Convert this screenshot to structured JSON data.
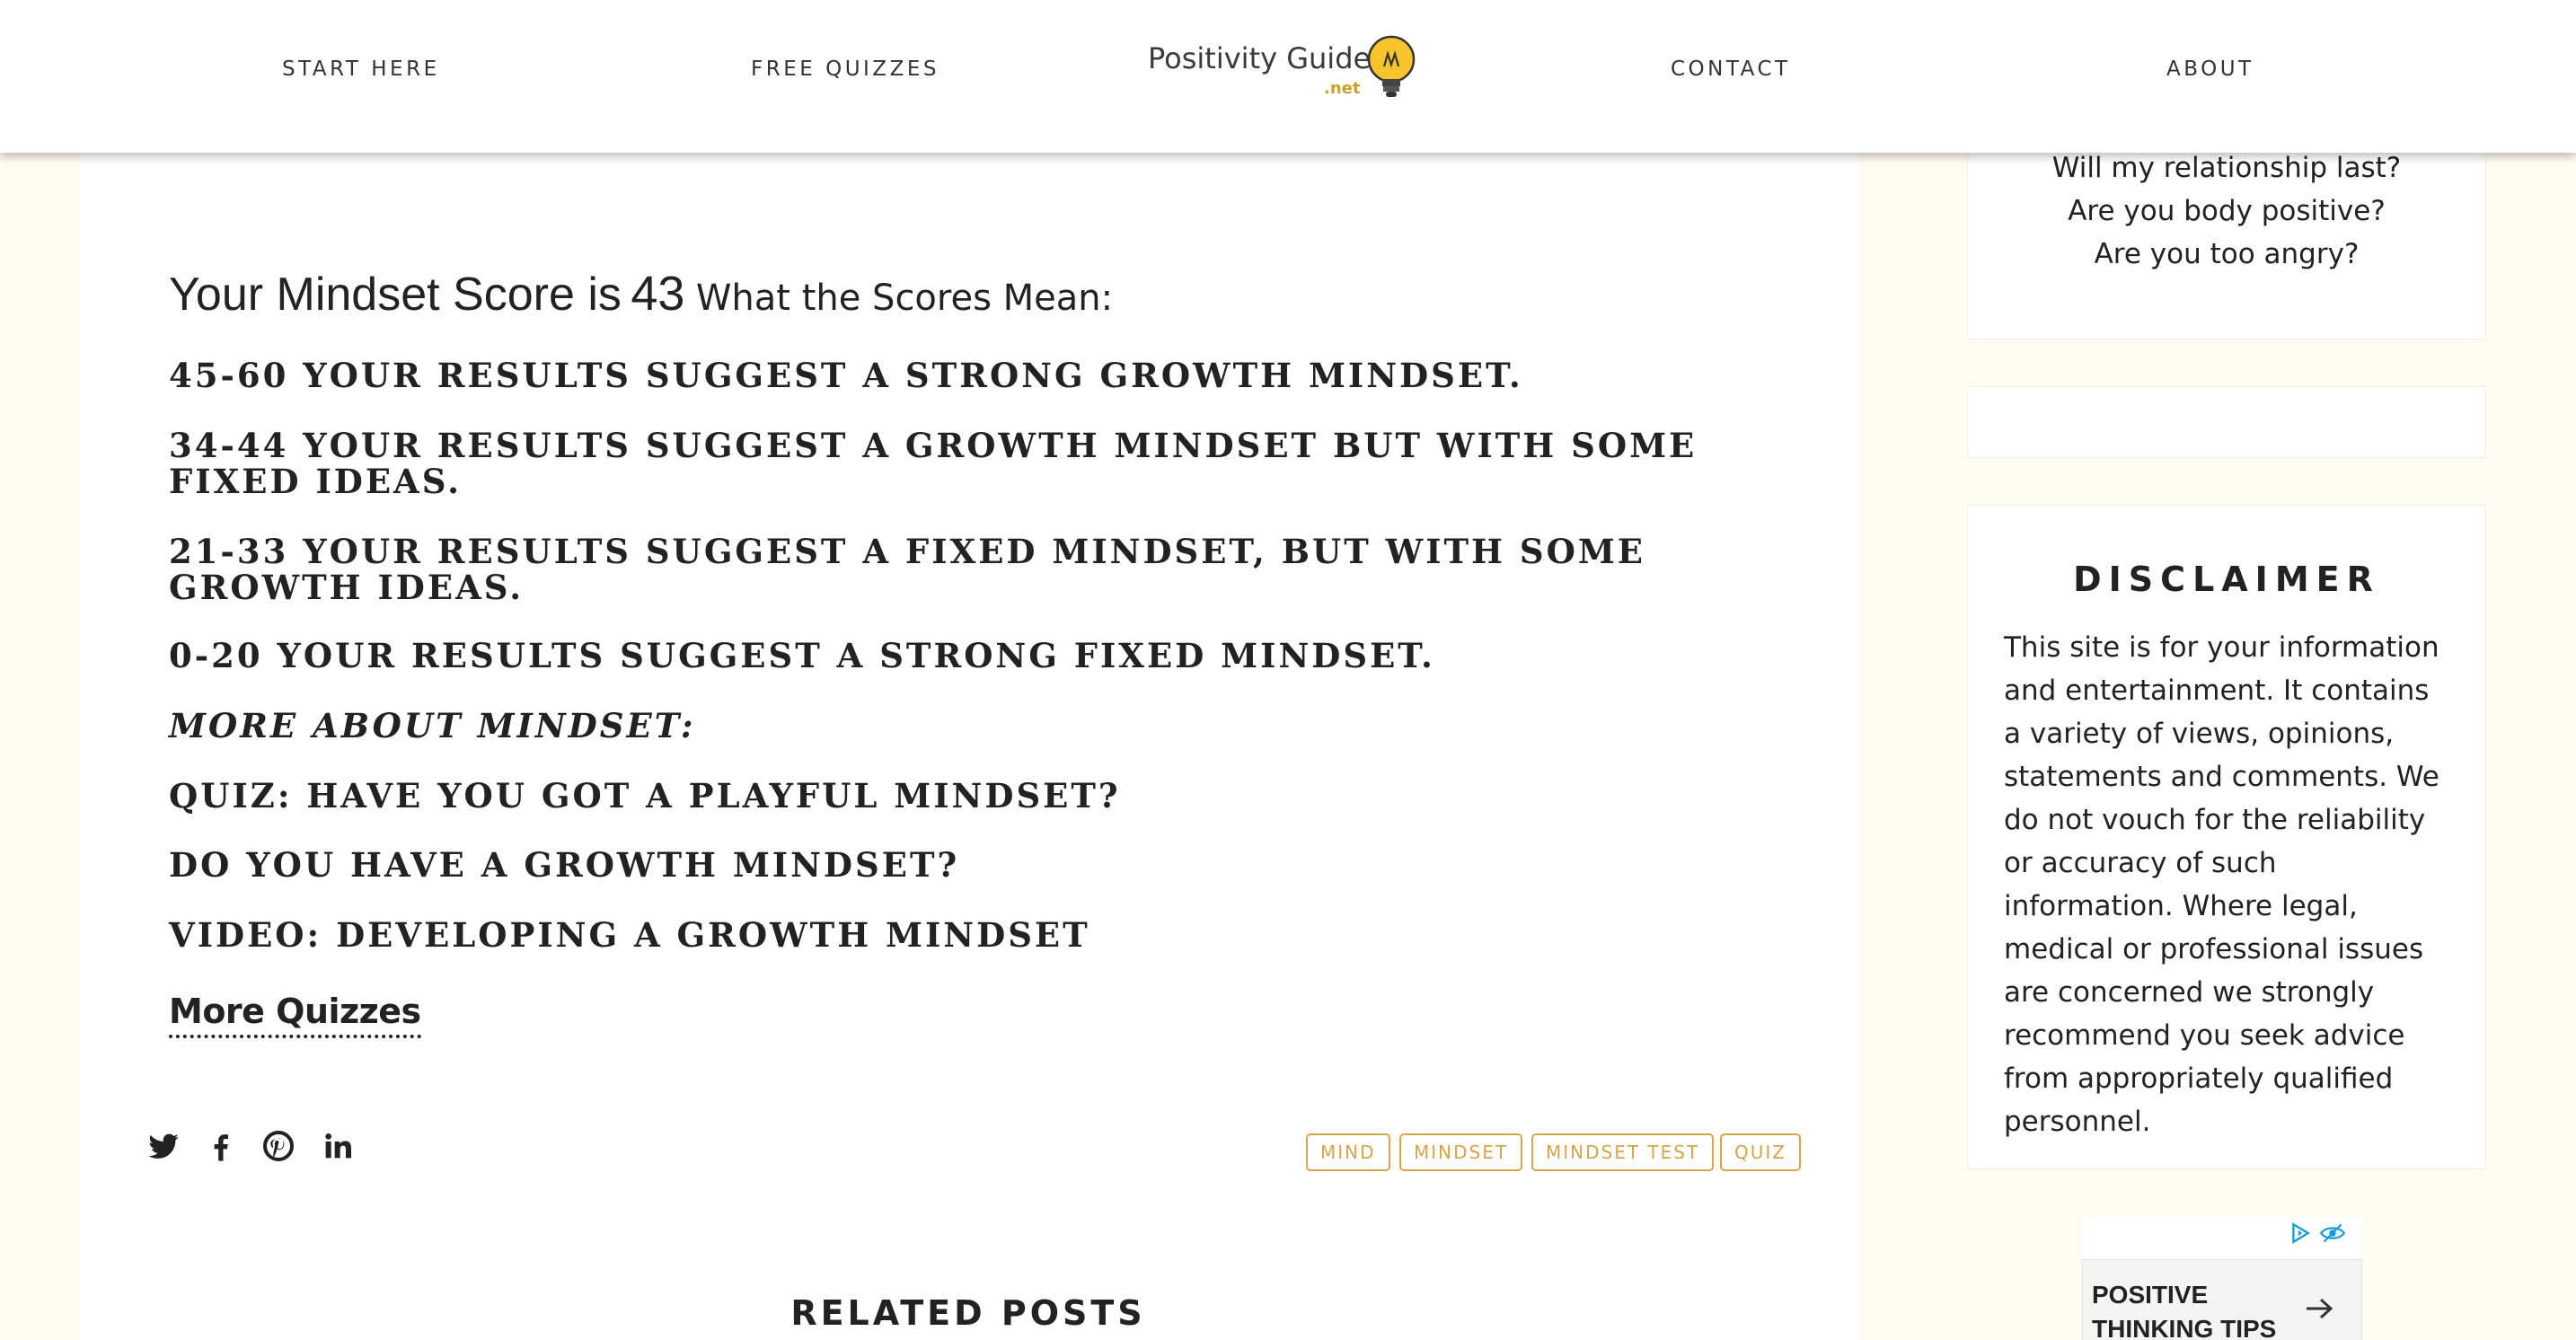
{
  "header": {
    "nav": [
      {
        "label": "START HERE"
      },
      {
        "label": "FREE QUIZZES"
      },
      {
        "label": "CONTACT"
      },
      {
        "label": "ABOUT"
      }
    ],
    "logo": {
      "name": "Positivity Guides",
      "tld": ".net",
      "icon": "lightbulb-icon"
    }
  },
  "main": {
    "score_label": "Your Mindset Score is",
    "score_value": "43",
    "scores_mean": "What the Scores Mean:",
    "headings": [
      "45-60 Your results suggest a strong growth mindset.",
      "34-44 Your results suggest a growth mindset but with some fixed ideas.",
      "21-33 Your results suggest a fixed mindset, but with some growth ideas.",
      "0-20 Your results suggest a strong fixed mindset.",
      "More about mindset:",
      "Quiz: Have You Got a Playful Mindset?",
      "Do You Have a Growth Mindset?",
      "Video: Developing a Growth Mindset"
    ],
    "more_quizzes": "More Quizzes",
    "social": [
      "twitter-icon",
      "facebook-icon",
      "pinterest-icon",
      "linkedin-icon"
    ],
    "tags": [
      "MIND",
      "MINDSET",
      "MINDSET TEST",
      "QUIZ"
    ],
    "related_posts": "RELATED POSTS"
  },
  "sidebar": {
    "quiz_links": [
      "Will my relationship last?",
      "Are you body positive?",
      "Are you too angry?"
    ],
    "disclaimer": {
      "title": "DISCLAIMER",
      "text": "This site is for your information and entertainment. It contains a variety of views, opinions, statements and comments. We do not vouch for the reliability or accuracy of such information. Where legal, medical or professional issues are concerned we strongly recommend you seek advice from appropriately qualified personnel."
    },
    "ad": {
      "card_text": "POSITIVE THINKING TIPS",
      "icons": [
        "adchoices-icon",
        "hide-ad-icon",
        "arrow-right-icon"
      ]
    }
  },
  "colors": {
    "page_background": "#fffcf3",
    "tag_accent": "#d4a54a",
    "logo_accent": "#c7a12a",
    "bulb_yellow": "#f6c42b"
  }
}
